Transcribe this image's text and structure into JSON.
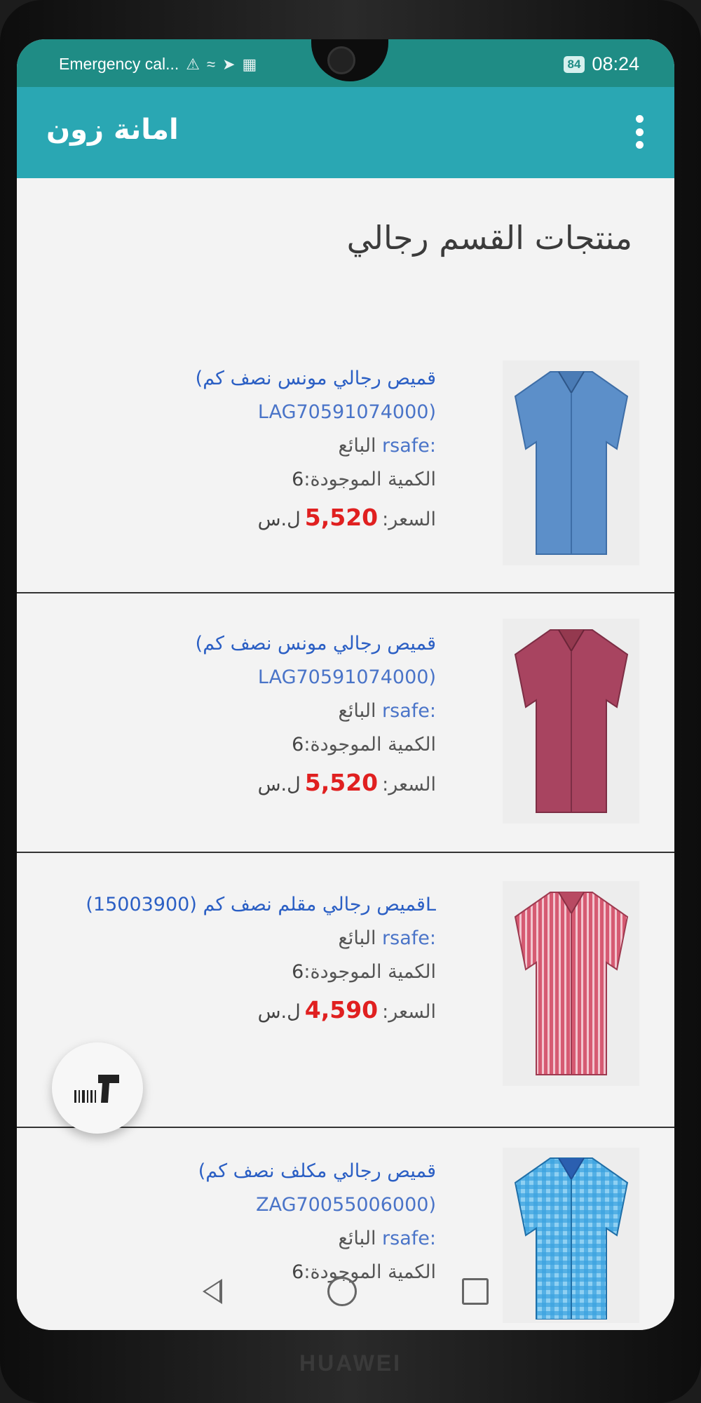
{
  "status_bar": {
    "carrier": "Emergency cal...",
    "battery": "84",
    "time": "08:24"
  },
  "app_bar": {
    "title": "امانة زون",
    "menu_icon": "more-vert-icon"
  },
  "page": {
    "title": "منتجات القسم رجالي"
  },
  "products": [
    {
      "name": "قميص رجالي مونس نصف كم)",
      "sku": "(LAG70591074000",
      "seller_label": "البائع",
      "seller": ":rsafe",
      "quantity_label": "الكمية الموجودة:",
      "quantity": "6",
      "price_label": "السعر:",
      "price": "5,520",
      "currency": "ل.س",
      "shirt_color": "#5c8fc9"
    },
    {
      "name": "قميص رجالي مونس نصف كم)",
      "sku": "(LAG70591074000",
      "seller_label": "البائع",
      "seller": ":rsafe",
      "quantity_label": "الكمية الموجودة:",
      "quantity": "6",
      "price_label": "السعر:",
      "price": "5,520",
      "currency": "ل.س",
      "shirt_color": "#a84460"
    },
    {
      "name": "Lقميص رجالي مقلم نصف كم (15003900)",
      "seller_label": "البائع",
      "seller": ":rsafe",
      "quantity_label": "الكمية الموجودة:",
      "quantity": "6",
      "price_label": "السعر:",
      "price": "4,590",
      "currency": "ل.س",
      "shirt_color": "#c94a62"
    },
    {
      "name": "قميص رجالي مكلف نصف كم)",
      "sku": "(ZAG70055006000",
      "seller_label": "البائع",
      "seller": ":rsafe",
      "quantity_label": "الكمية الموجودة:",
      "quantity": "6",
      "shirt_color": "#3aa3e0"
    }
  ],
  "fab": {
    "icon": "barcode-scanner-icon"
  },
  "nav": {
    "back": "back-icon",
    "home": "home-icon",
    "recent": "recent-apps-icon"
  },
  "device": {
    "brand": "HUAWEI"
  }
}
